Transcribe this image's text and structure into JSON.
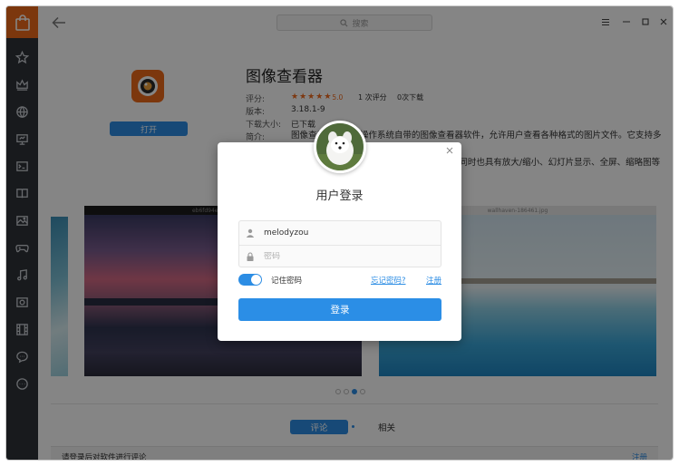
{
  "titlebar": {
    "search_placeholder": "搜索"
  },
  "app": {
    "name": "图像查看器",
    "open_label": "打开",
    "rating_label": "评分:",
    "rating_value": "5.0",
    "rating_count": "1 次评分",
    "download_count": "0次下载",
    "version_label": "版本:",
    "version_value": "3.18.1-9",
    "size_label": "下载大小:",
    "size_value": "已下载",
    "intro_label": "简介:",
    "intro_line1": "图像查看器是深度操作系统自带的图像查看器软件，允许用户查看各种格式的图片文件。它支持多种图片格式，如",
    "intro_line2": "BMP、JPEG、PNG、ICO、SVG、TIFF等，同时也具有放大/缩小、幻灯片显示、全屏、缩略图等功",
    "intro_line3": "能，"
  },
  "screenshots": {
    "center_title": "eb6fd94ec0d674461...",
    "right_title": "wallhaven-186461.jpg"
  },
  "tabs": {
    "comment": "评论",
    "related": "相关"
  },
  "comment_bar": {
    "hint": "请登录后对软件进行评论",
    "register": "注册"
  },
  "login": {
    "title": "用户登录",
    "username": "melodyzou",
    "password_placeholder": "密码",
    "remember": "记住密码",
    "forgot": "忘记密码?",
    "register": "注册",
    "submit": "登录"
  },
  "colors": {
    "accent": "#2c8de4",
    "brand_orange": "#ee6a19",
    "sidebar": "#2e3239"
  }
}
